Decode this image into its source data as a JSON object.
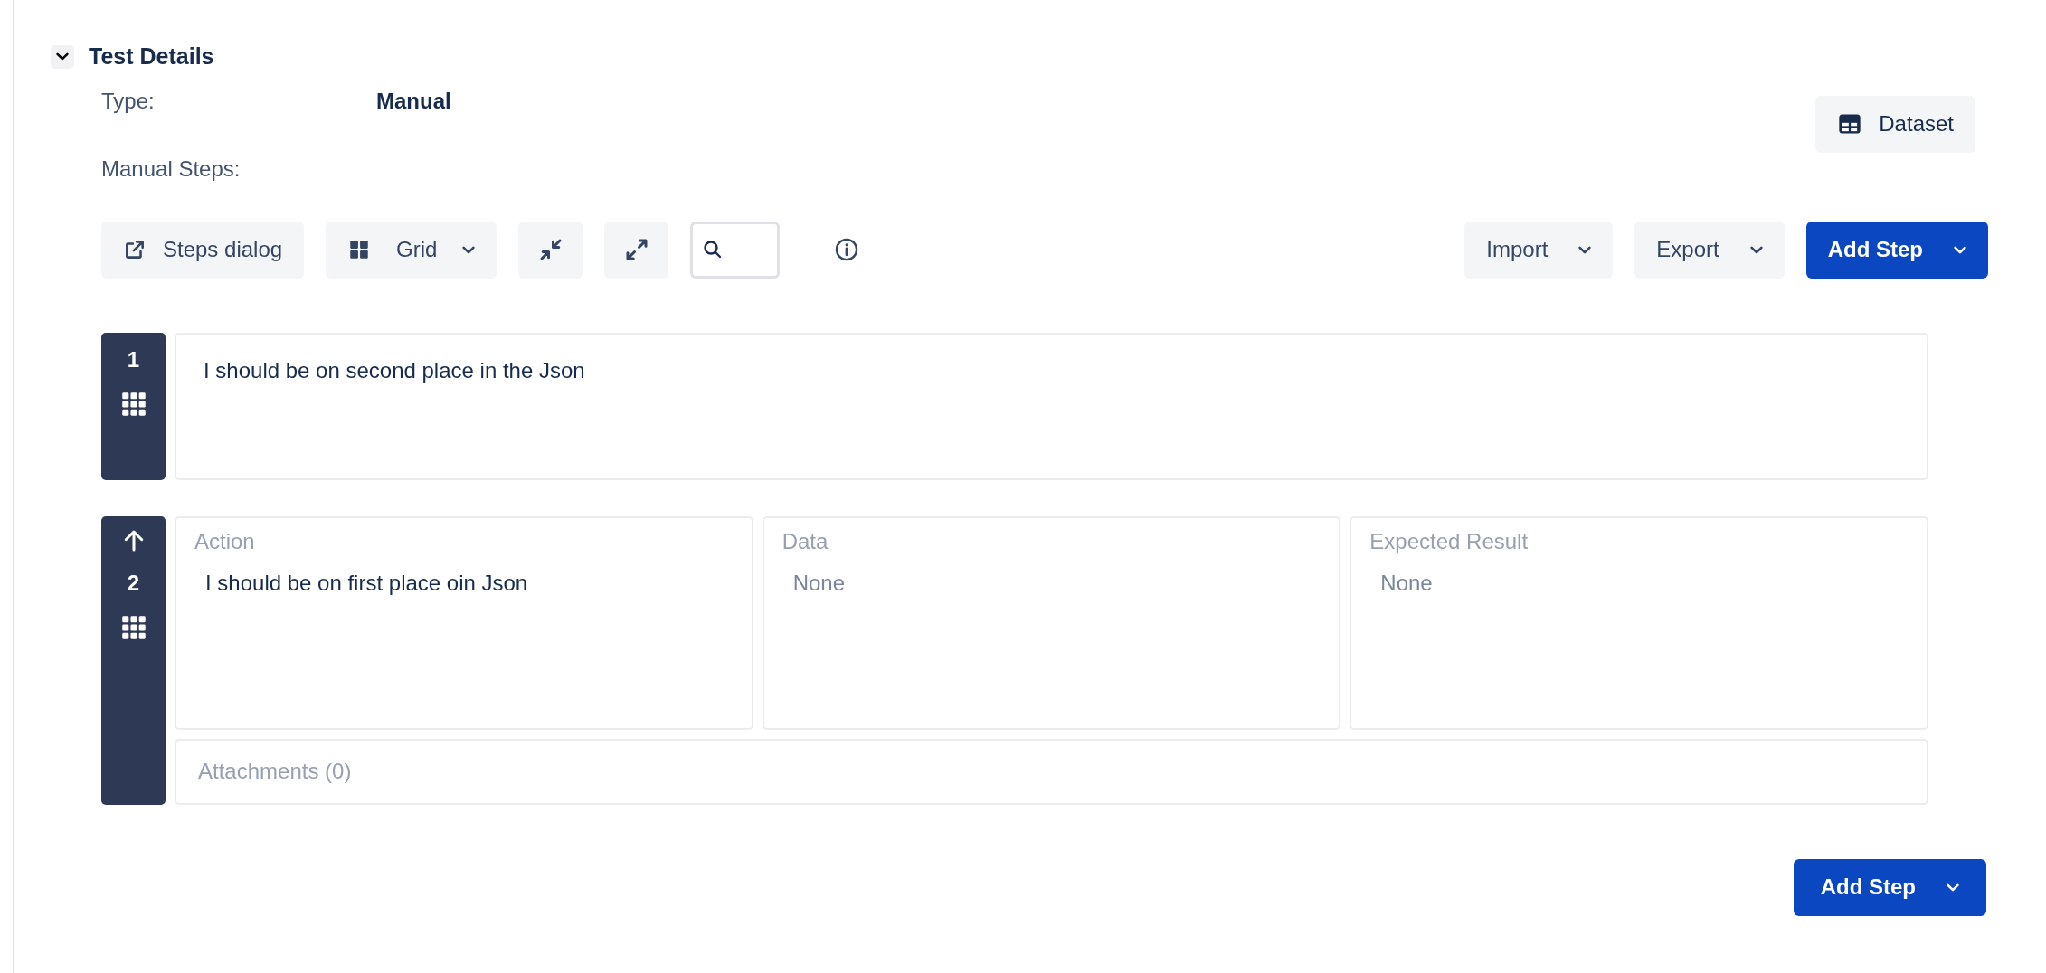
{
  "section": {
    "title": "Test Details",
    "expanded": true
  },
  "type_row": {
    "label": "Type:",
    "value": "Manual"
  },
  "dataset_button": "Dataset",
  "steps_label": "Manual Steps:",
  "toolbar": {
    "steps_dialog": "Steps dialog",
    "layout": "Grid"
  },
  "actions": [
    {
      "label": "Import",
      "primary": false
    },
    {
      "label": "Export",
      "primary": false
    },
    {
      "label": "Add Step",
      "primary": true
    }
  ],
  "steps": [
    {
      "number": "1",
      "expanded": false,
      "text": "I should be on second place in the Json"
    },
    {
      "number": "2",
      "expanded": true,
      "fields": [
        {
          "label": "Action",
          "value": "I should be on first place oin Json",
          "muted": false
        },
        {
          "label": "Data",
          "value": "None",
          "muted": true
        },
        {
          "label": "Expected Result",
          "value": "None",
          "muted": true
        }
      ],
      "attachments": "Attachments (0)"
    }
  ],
  "footer_button": {
    "label": "Add Step",
    "primary": true
  }
}
